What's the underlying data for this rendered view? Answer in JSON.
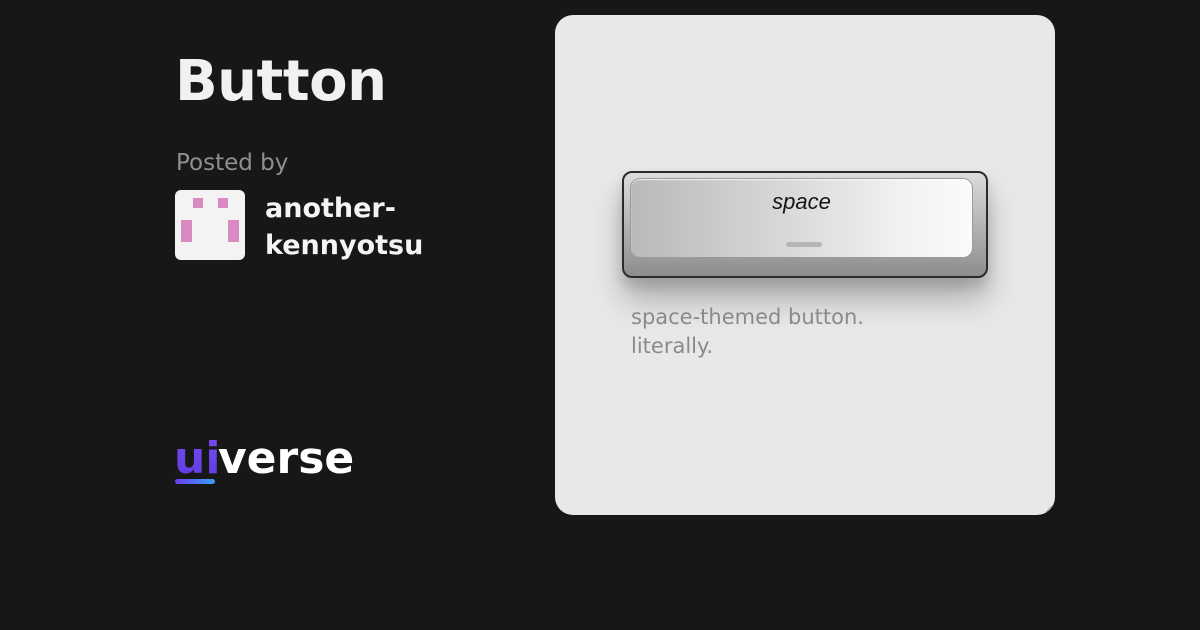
{
  "post": {
    "title": "Button",
    "posted_by_label": "Posted by",
    "author_line1": "another-",
    "author_line2": "kennyotsu"
  },
  "logo": {
    "prefix": "ui",
    "suffix": "verse",
    "prefix_gradient": [
      "#6a3df0",
      "#3aa0f5"
    ]
  },
  "preview": {
    "button_label": "space",
    "description": "space-themed button. literally."
  },
  "colors": {
    "background": "#171717",
    "card": "#e8e8e8",
    "avatar_accent": "#d98ac2"
  }
}
